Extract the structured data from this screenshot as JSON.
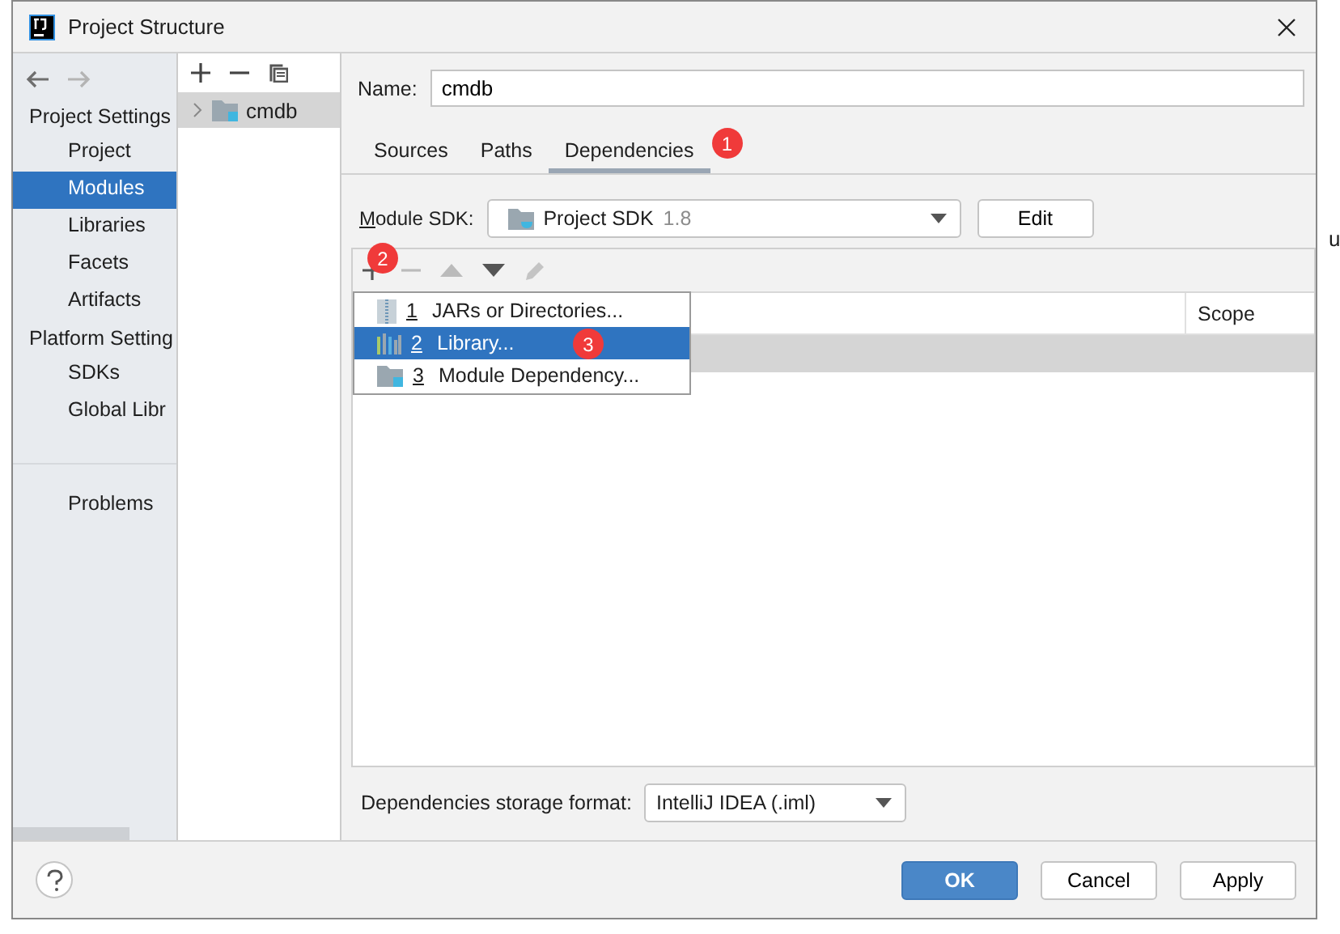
{
  "window": {
    "title": "Project Structure"
  },
  "nav": {
    "sections": [
      {
        "title": "Project Settings",
        "items": [
          {
            "label": "Project",
            "selected": false
          },
          {
            "label": "Modules",
            "selected": true
          },
          {
            "label": "Libraries",
            "selected": false
          },
          {
            "label": "Facets",
            "selected": false
          },
          {
            "label": "Artifacts",
            "selected": false
          }
        ]
      },
      {
        "title": "Platform Setting",
        "items": [
          {
            "label": "SDKs",
            "selected": false
          },
          {
            "label": "Global Libr",
            "selected": false
          }
        ]
      }
    ],
    "problems": "Problems"
  },
  "tree": {
    "items": [
      {
        "label": "cmdb",
        "selected": true,
        "expanded": false
      }
    ]
  },
  "name": {
    "label": "Name:",
    "value": "cmdb"
  },
  "tabs": [
    {
      "label": "Sources",
      "selected": false
    },
    {
      "label": "Paths",
      "selected": false
    },
    {
      "label": "Dependencies",
      "selected": true,
      "annotation": "1"
    }
  ],
  "module_sdk": {
    "label": "Module SDK:",
    "value": "Project SDK",
    "version": "1.8",
    "edit_button": "Edit"
  },
  "dependencies": {
    "add_annotation": "2",
    "columns": [
      "",
      "Scope"
    ],
    "rows": [
      {
        "selected": true
      }
    ],
    "popup": [
      {
        "key": "1",
        "label": "JARs or Directories...",
        "kind": "jar",
        "selected": false
      },
      {
        "key": "2",
        "label": "Library...",
        "kind": "library",
        "selected": true,
        "annotation": "3"
      },
      {
        "key": "3",
        "label": "Module Dependency...",
        "kind": "module",
        "selected": false
      }
    ]
  },
  "storage": {
    "label": "Dependencies storage format:",
    "value": "IntelliJ IDEA (.iml)"
  },
  "buttons": [
    {
      "label": "OK",
      "kind": "primary"
    },
    {
      "label": "Cancel",
      "kind": "normal"
    },
    {
      "label": "Apply",
      "kind": "normal"
    }
  ],
  "background": {
    "edge_text": "u"
  }
}
